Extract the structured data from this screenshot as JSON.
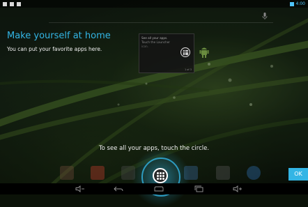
{
  "cling": {
    "title": "Make yourself at home",
    "body": "You can put your favorite apps here.",
    "hint": "To see all your apps, touch the circle.",
    "ok_label": "OK"
  },
  "preview": {
    "line1": "See all your apps.",
    "line2": "Touch the Launcher",
    "line3": "icon.",
    "page_indicator": "1 of 3"
  },
  "status": {
    "clock": "4:00"
  },
  "colors": {
    "accent": "#33b5e5",
    "text": "#f2f2f2",
    "navbar": "#000000"
  },
  "icons": {
    "search": "mic-icon",
    "all_apps": "all-apps-icon",
    "nav": [
      "volume-down-icon",
      "back-icon",
      "home-icon",
      "recents-icon",
      "volume-up-icon"
    ],
    "hotseat": [
      "maps-icon",
      "gmail-icon",
      "video-icon",
      "all-apps-icon",
      "browser-icon",
      "movie-studio-icon",
      "earth-icon"
    ]
  }
}
